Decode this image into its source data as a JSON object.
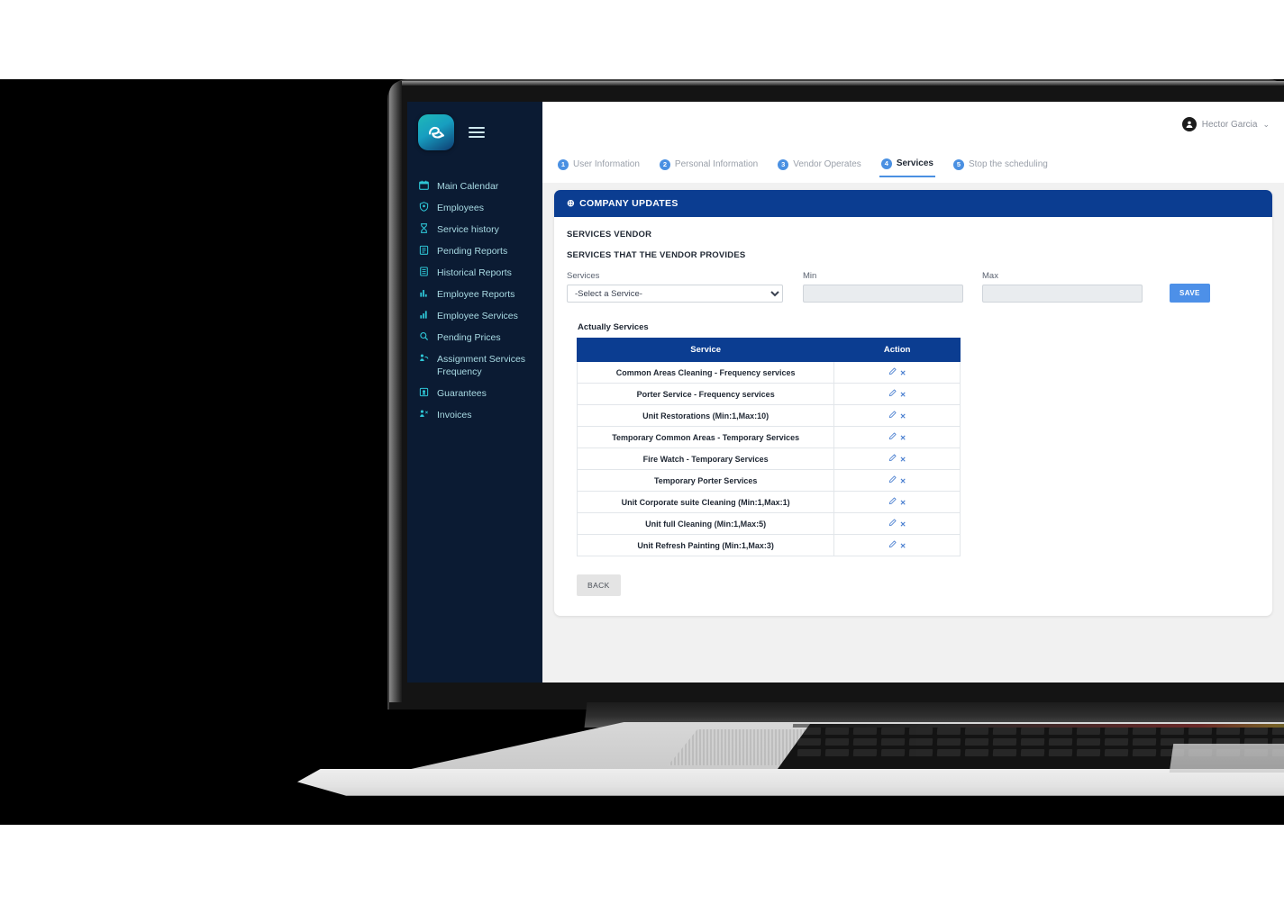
{
  "app": {
    "logo_icon": "brand-e-arrow-icon",
    "menu_icon": "hamburger-menu-icon",
    "accent_navy": "#0b3d91",
    "accent_blue": "#4a90e2",
    "sidebar_bg": "#0b1b33"
  },
  "topbar": {
    "avatar_icon": "user-avatar-icon",
    "user_name": "Hector Garcia",
    "chevron_icon": "chevron-down-icon",
    "chevron_glyph": "⌄"
  },
  "sidebar": {
    "items": [
      {
        "label": "Main Calendar",
        "icon": "calendar-icon"
      },
      {
        "label": "Employees",
        "icon": "badge-icon"
      },
      {
        "label": "Service history",
        "icon": "hourglass-icon"
      },
      {
        "label": "Pending Reports",
        "icon": "clipboard-icon"
      },
      {
        "label": "Historical Reports",
        "icon": "book-icon"
      },
      {
        "label": "Employee Reports",
        "icon": "bar-chart-icon"
      },
      {
        "label": "Employee Services",
        "icon": "bar-chart-alt-icon"
      },
      {
        "label": "Pending Prices",
        "icon": "search-price-icon"
      },
      {
        "label": "Assignment Services Frequency",
        "icon": "assignment-icon"
      },
      {
        "label": "Guarantees",
        "icon": "guarantee-icon"
      },
      {
        "label": "Invoices",
        "icon": "invoice-icon"
      }
    ]
  },
  "steps": [
    {
      "num": "1",
      "label": "User Information",
      "active": false
    },
    {
      "num": "2",
      "label": "Personal Information",
      "active": false
    },
    {
      "num": "3",
      "label": "Vendor Operates",
      "active": false
    },
    {
      "num": "4",
      "label": "Services",
      "active": true
    },
    {
      "num": "5",
      "label": "Stop the scheduling",
      "active": false
    }
  ],
  "card": {
    "header_icon": "plus-circle-icon",
    "header_glyph": "⊕",
    "header_title": "COMPANY UPDATES",
    "section_title": "SERVICES VENDOR",
    "subsection_title": "SERVICES THAT THE VENDOR PROVIDES"
  },
  "form": {
    "services_label": "Services",
    "services_value": "-Select a Service-",
    "services_options": [
      "-Select a Service-"
    ],
    "min_label": "Min",
    "min_value": "",
    "min_placeholder": "",
    "max_label": "Max",
    "max_value": "",
    "max_placeholder": "",
    "save_label": "SAVE"
  },
  "table": {
    "title": "Actually Services",
    "columns": [
      "Service",
      "Action"
    ],
    "edit_icon": "pencil-edit-icon",
    "delete_icon": "close-delete-icon",
    "delete_glyph": "✕",
    "rows": [
      {
        "service": "Common Areas Cleaning - Frequency services"
      },
      {
        "service": "Porter Service - Frequency services"
      },
      {
        "service": "Unit Restorations (Min:1,Max:10)"
      },
      {
        "service": "Temporary Common Areas - Temporary Services"
      },
      {
        "service": "Fire Watch - Temporary Services"
      },
      {
        "service": "Temporary Porter Services"
      },
      {
        "service": "Unit Corporate suite Cleaning (Min:1,Max:1)"
      },
      {
        "service": "Unit full Cleaning (Min:1,Max:5)"
      },
      {
        "service": "Unit Refresh Painting (Min:1,Max:3)"
      }
    ]
  },
  "footer": {
    "back_label": "BACK"
  }
}
